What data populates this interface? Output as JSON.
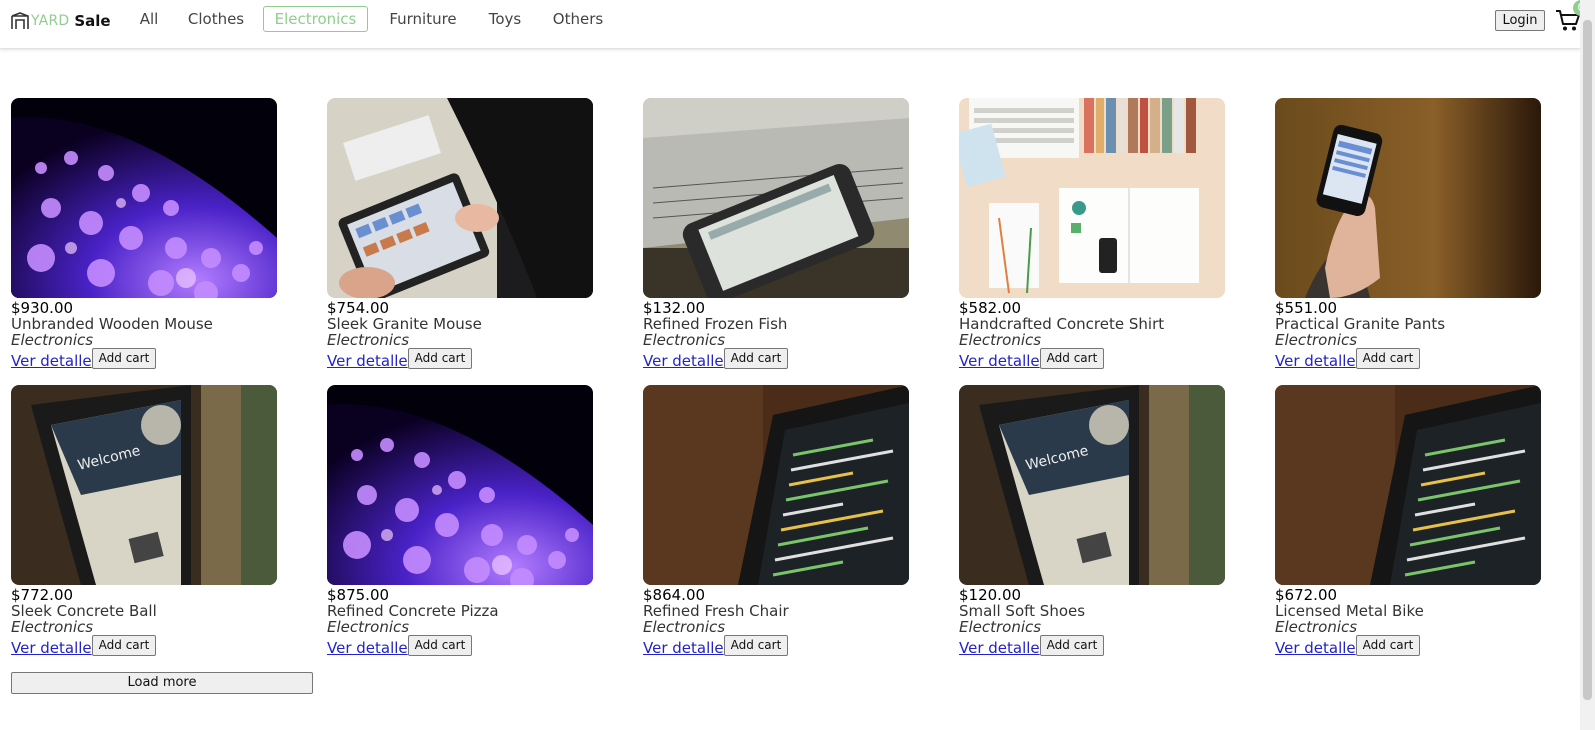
{
  "brand": {
    "prefix": "YARD",
    "name": "Sale",
    "accent": "#8fce8f",
    "logo_icon": "storefront-icon"
  },
  "nav": [
    {
      "label": "All",
      "active": false
    },
    {
      "label": "Clothes",
      "active": false
    },
    {
      "label": "Electronics",
      "active": true
    },
    {
      "label": "Furniture",
      "active": false
    },
    {
      "label": "Toys",
      "active": false
    },
    {
      "label": "Others",
      "active": false
    }
  ],
  "header": {
    "login_label": "Login",
    "cart_icon": "cart-icon",
    "cart_count": "0"
  },
  "products": [
    {
      "price": "$930.00",
      "name": "Unbranded Wooden Mouse",
      "category": "Electronics",
      "image": "fiber-optic"
    },
    {
      "price": "$754.00",
      "name": "Sleek Granite Mouse",
      "category": "Electronics",
      "image": "tablet-hands"
    },
    {
      "price": "$132.00",
      "name": "Refined Frozen Fish",
      "category": "Electronics",
      "image": "phone-laptop"
    },
    {
      "price": "$582.00",
      "name": "Handcrafted Concrete Shirt",
      "category": "Electronics",
      "image": "desk-flatlay"
    },
    {
      "price": "$551.00",
      "name": "Practical Granite Pants",
      "category": "Electronics",
      "image": "hand-phone"
    },
    {
      "price": "$772.00",
      "name": "Sleek Concrete Ball",
      "category": "Electronics",
      "image": "tablet-welcome"
    },
    {
      "price": "$875.00",
      "name": "Refined Concrete Pizza",
      "category": "Electronics",
      "image": "fiber-optic"
    },
    {
      "price": "$864.00",
      "name": "Refined Fresh Chair",
      "category": "Electronics",
      "image": "code-screen"
    },
    {
      "price": "$120.00",
      "name": "Small Soft Shoes",
      "category": "Electronics",
      "image": "tablet-welcome"
    },
    {
      "price": "$672.00",
      "name": "Licensed Metal Bike",
      "category": "Electronics",
      "image": "code-screen"
    }
  ],
  "product_actions": {
    "detail_label": "Ver detalle",
    "add_label": "Add cart"
  },
  "load_more_label": "Load more"
}
